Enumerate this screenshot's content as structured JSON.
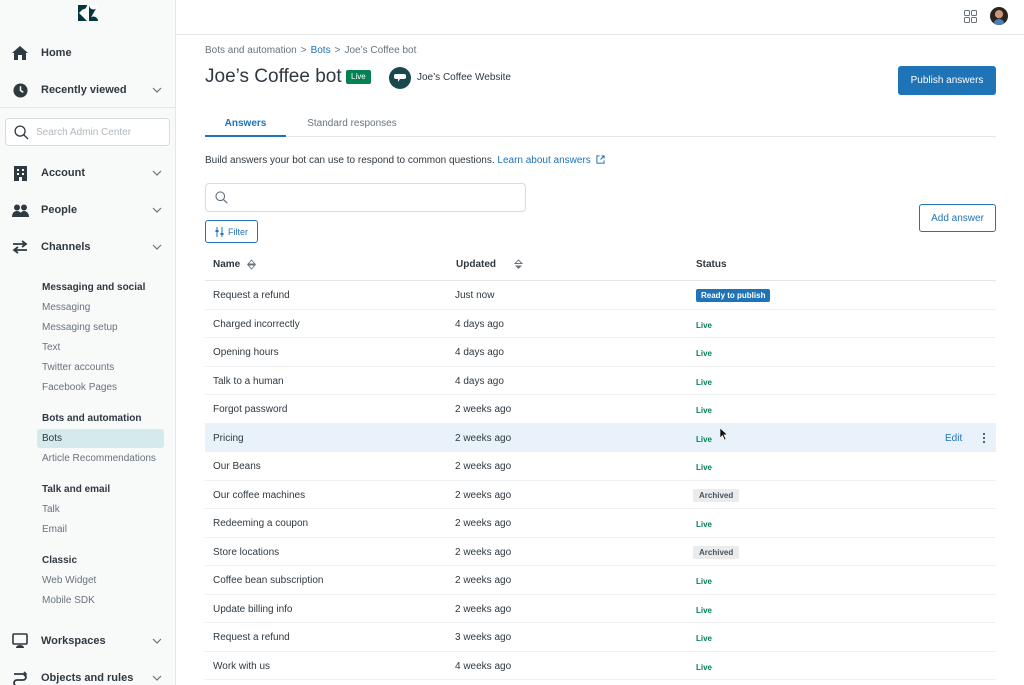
{
  "sidebar": {
    "top_items": [
      {
        "label": "Home",
        "icon": "home-icon"
      },
      {
        "label": "Recently viewed",
        "icon": "clock-icon",
        "expandable": true
      }
    ],
    "search_placeholder": "Search Admin Center",
    "sections": [
      {
        "label": "Account",
        "icon": "building-icon"
      },
      {
        "label": "People",
        "icon": "people-icon"
      },
      {
        "label": "Channels",
        "icon": "arrows-icon"
      }
    ],
    "channels_groups": [
      {
        "heading": "Messaging and social",
        "items": [
          "Messaging",
          "Messaging setup",
          "Text",
          "Twitter accounts",
          "Facebook Pages"
        ]
      },
      {
        "heading": "Bots and automation",
        "items": [
          "Bots",
          "Article Recommendations"
        ],
        "active": "Bots"
      },
      {
        "heading": "Talk and email",
        "items": [
          "Talk",
          "Email"
        ]
      },
      {
        "heading": "Classic",
        "items": [
          "Web Widget",
          "Mobile SDK"
        ]
      }
    ],
    "bottom_items": [
      {
        "label": "Workspaces",
        "icon": "monitor-icon"
      },
      {
        "label": "Objects and rules",
        "icon": "routing-icon"
      }
    ]
  },
  "breadcrumb": {
    "items": [
      "Bots and automation",
      "Bots",
      "Joe’s Coffee bot"
    ],
    "separator": ">"
  },
  "header": {
    "title": "Joe’s Coffee bot",
    "status_badge": "Live",
    "channel_name": "Joe’s Coffee Website",
    "publish_label": "Publish answers"
  },
  "tabs": [
    {
      "label": "Answers",
      "active": true
    },
    {
      "label": "Standard responses",
      "active": false
    }
  ],
  "description": {
    "text": "Build answers your bot can use to respond to common questions.",
    "link": "Learn about answers"
  },
  "search": {
    "value": "",
    "placeholder": ""
  },
  "filter_label": "Filter",
  "add_answer_label": "Add answer",
  "table": {
    "columns": [
      "Name",
      "Updated",
      "Status"
    ],
    "rows": [
      {
        "name": "Request a refund",
        "updated": "Just now",
        "status": "Ready to publish"
      },
      {
        "name": "Charged incorrectly",
        "updated": "4 days ago",
        "status": "Live"
      },
      {
        "name": "Opening hours",
        "updated": "4 days ago",
        "status": "Live"
      },
      {
        "name": "Talk to a human",
        "updated": "4 days ago",
        "status": "Live"
      },
      {
        "name": "Forgot password",
        "updated": "2 weeks ago",
        "status": "Live"
      },
      {
        "name": "Pricing",
        "updated": "2 weeks ago",
        "status": "Live",
        "hovered": true
      },
      {
        "name": "Our Beans",
        "updated": "2 weeks ago",
        "status": "Live"
      },
      {
        "name": "Our coffee machines",
        "updated": "2 weeks ago",
        "status": "Archived"
      },
      {
        "name": "Redeeming a coupon",
        "updated": "2 weeks ago",
        "status": "Live"
      },
      {
        "name": "Store locations",
        "updated": "2 weeks ago",
        "status": "Archived"
      },
      {
        "name": "Coffee bean subscription",
        "updated": "2 weeks ago",
        "status": "Live"
      },
      {
        "name": "Update billing info",
        "updated": "2 weeks ago",
        "status": "Live"
      },
      {
        "name": "Request a refund",
        "updated": "3 weeks ago",
        "status": "Live"
      },
      {
        "name": "Work with us",
        "updated": "4 weeks ago",
        "status": "Live"
      }
    ],
    "row_actions": {
      "edit_label": "Edit"
    }
  },
  "colors": {
    "accent": "#1f73b7",
    "live_green": "#038153",
    "brand_dark": "#17494d",
    "active_nav_bg": "#d4eaeb",
    "hover_row_bg": "#e9f2fb"
  }
}
